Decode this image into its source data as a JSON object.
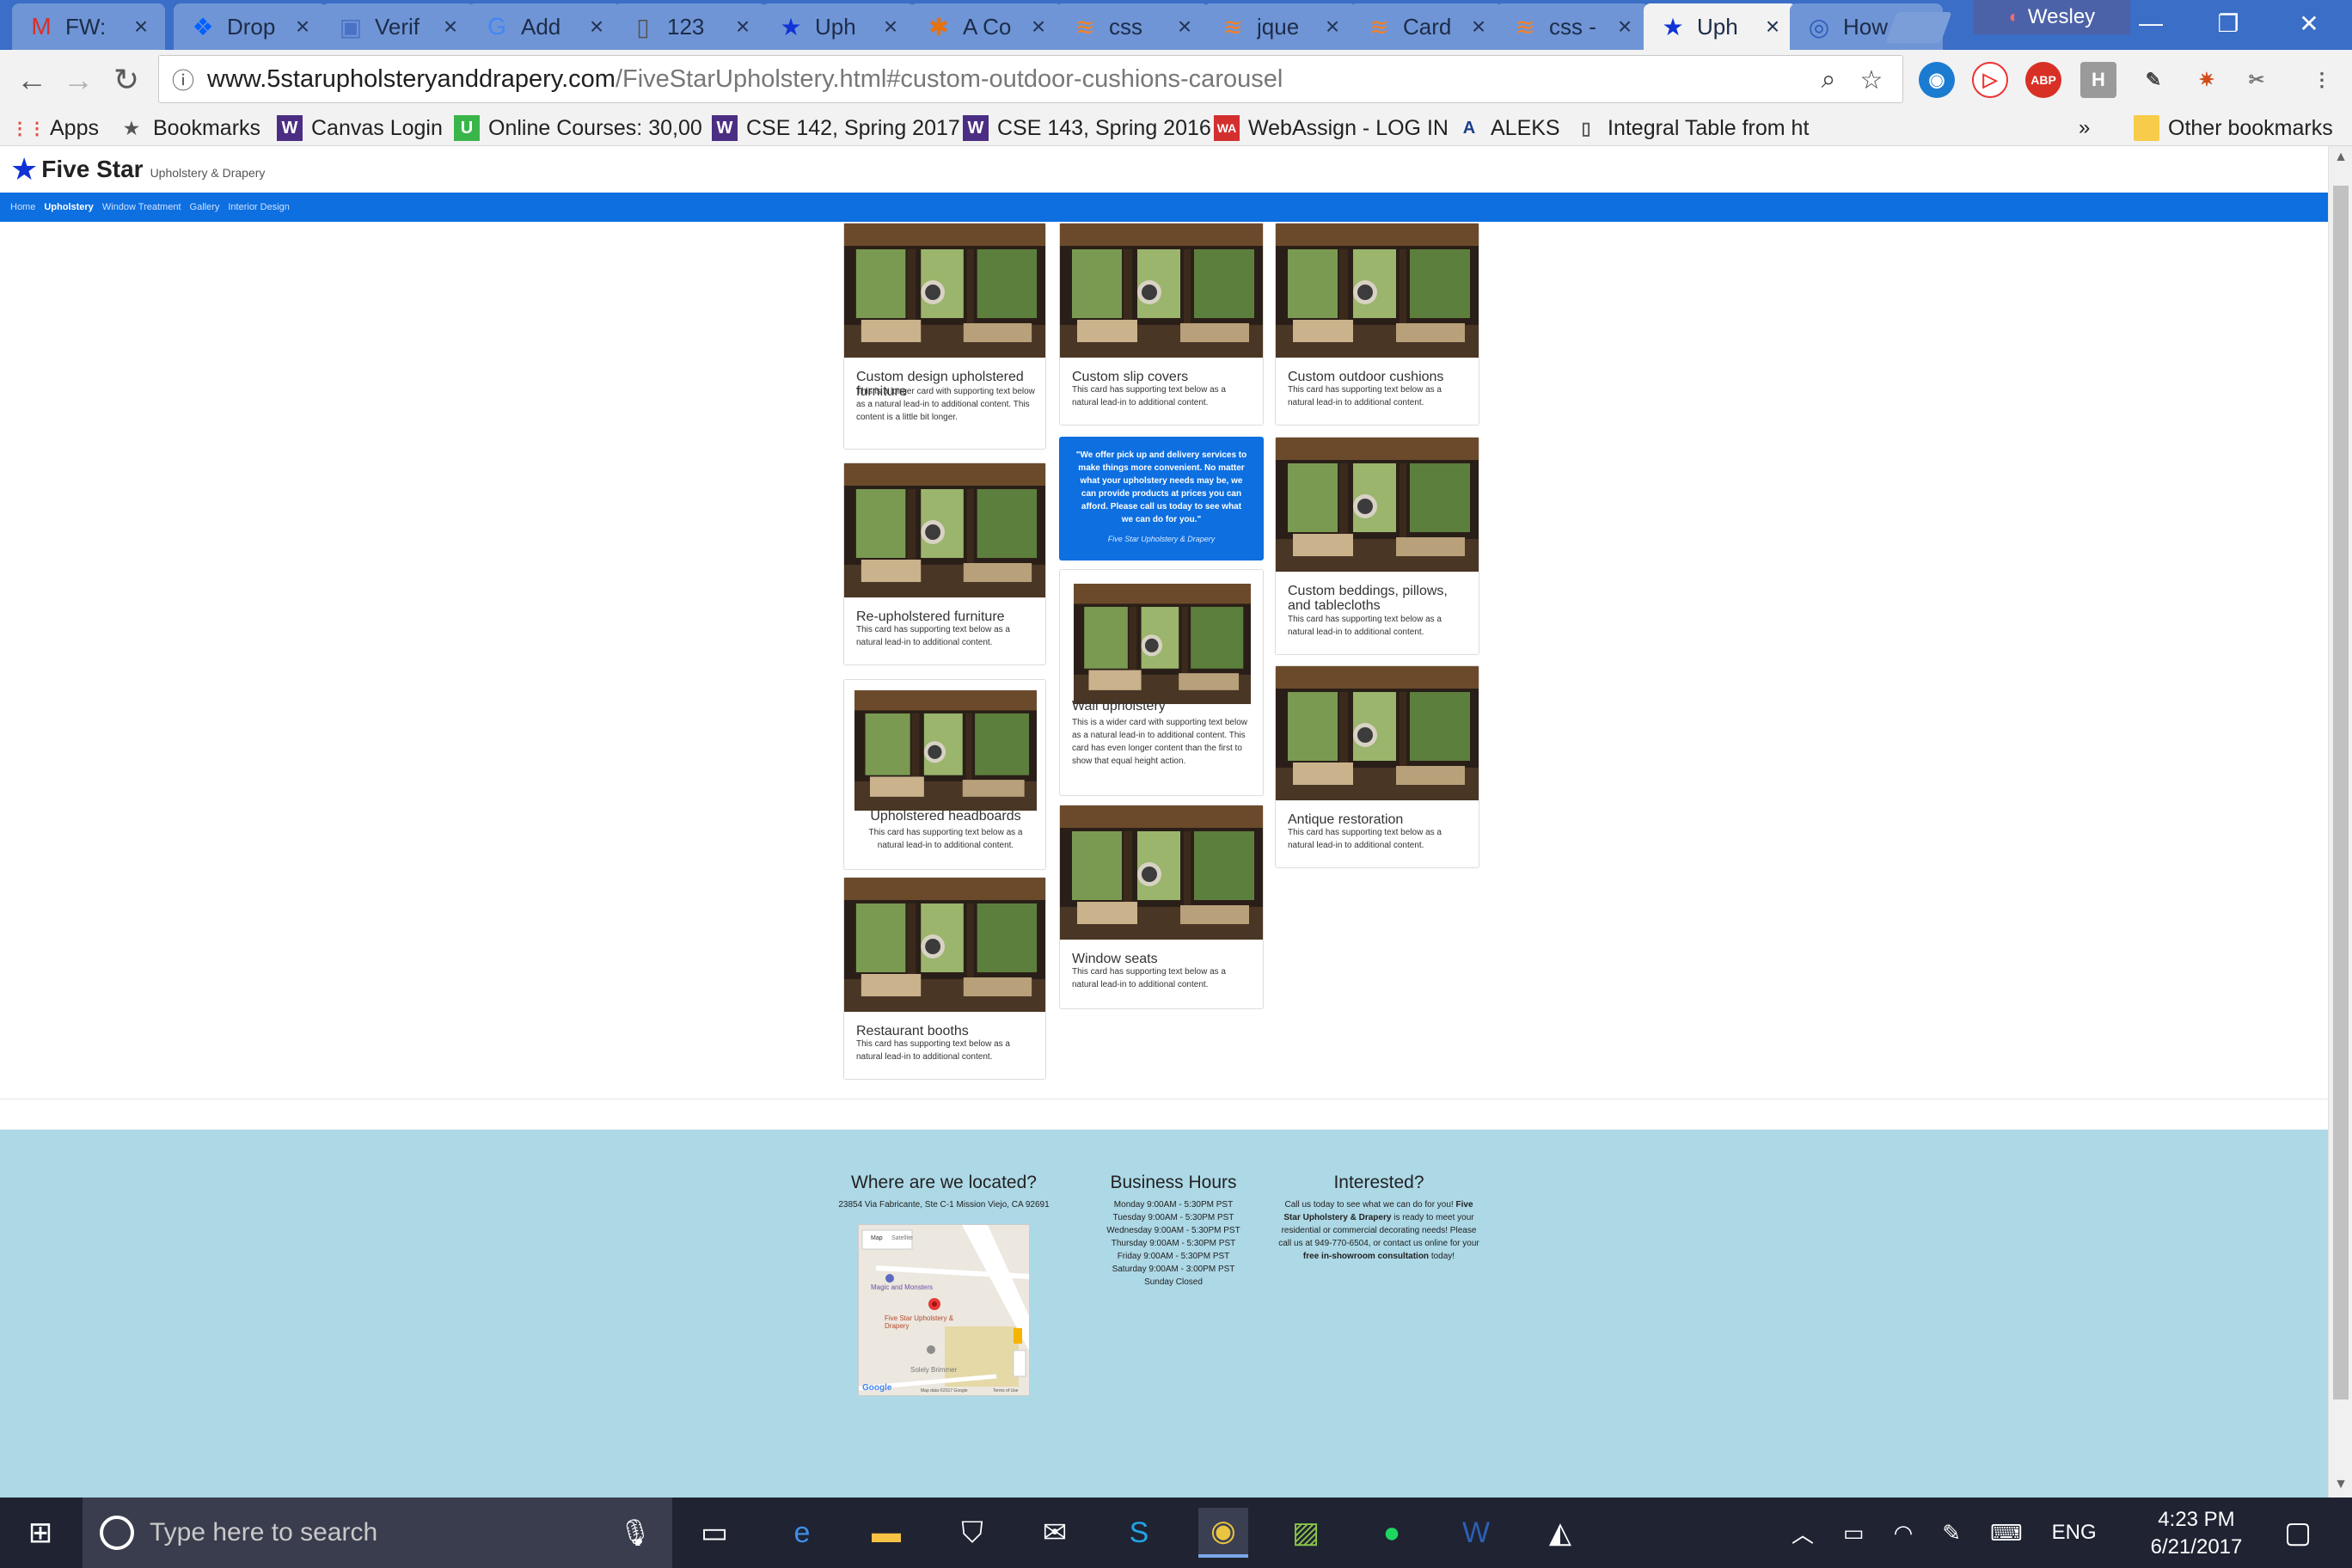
{
  "browser": {
    "tabs": [
      {
        "title": "FW:",
        "icon": "gmail-icon",
        "glyph": "M",
        "color": "#d93025"
      },
      {
        "title": "Drop",
        "icon": "dropbox-icon",
        "glyph": "❖",
        "color": "#0061fe"
      },
      {
        "title": "Verif",
        "icon": "account-icon",
        "glyph": "▣",
        "color": "#4a72c4"
      },
      {
        "title": "Add",
        "icon": "google-icon",
        "glyph": "G",
        "color": "#4285f4"
      },
      {
        "title": "123",
        "icon": "document-icon",
        "glyph": "▯",
        "color": "#555"
      },
      {
        "title": "Uph",
        "icon": "star-favicon-icon",
        "glyph": "★",
        "color": "#1033d6"
      },
      {
        "title": "A Co",
        "icon": "asterisk-icon",
        "glyph": "✱",
        "color": "#e8710a"
      },
      {
        "title": "css",
        "icon": "stackoverflow-icon",
        "glyph": "≋",
        "color": "#f48024"
      },
      {
        "title": "jque",
        "icon": "stackoverflow-icon",
        "glyph": "≋",
        "color": "#f48024"
      },
      {
        "title": "Card",
        "icon": "stackoverflow-icon",
        "glyph": "≋",
        "color": "#f48024"
      },
      {
        "title": "css -",
        "icon": "stackoverflow-icon",
        "glyph": "≋",
        "color": "#f48024"
      },
      {
        "title": "Uph",
        "icon": "star-favicon-icon",
        "glyph": "★",
        "color": "#1033d6",
        "active": true
      },
      {
        "title": "How",
        "icon": "search-favicon-icon",
        "glyph": "◎",
        "color": "#2a5bb8"
      }
    ],
    "profile_name": "Wesley",
    "url_host": "www.5starupholsteryanddrapery.com",
    "url_path": "/FiveStarUpholstery.html#custom-outdoor-cushions-carousel",
    "bookmarks": [
      {
        "label": "Apps",
        "icon": "apps-grid-icon"
      },
      {
        "label": "Bookmarks",
        "icon": "star-icon"
      },
      {
        "label": "Canvas Login",
        "icon": "uw-icon"
      },
      {
        "label": "Online Courses: 30,00",
        "icon": "udemy-icon"
      },
      {
        "label": "CSE 142, Spring 2017",
        "icon": "uw-icon"
      },
      {
        "label": "CSE 143, Spring 2016",
        "icon": "uw-icon"
      },
      {
        "label": "WebAssign - LOG IN",
        "icon": "webassign-icon"
      },
      {
        "label": "ALEKS",
        "icon": "aleks-icon"
      },
      {
        "label": "Integral Table from ht",
        "icon": "page-icon"
      }
    ],
    "bookmarks_overflow": "»",
    "other_bookmarks": "Other bookmarks"
  },
  "site": {
    "logo_text": "Five Star",
    "logo_subtext": "Upholstery & Drapery",
    "nav": [
      "Home",
      "Upholstery",
      "Window Treatment",
      "Gallery",
      "Interior Design"
    ],
    "nav_active": "Upholstery",
    "cards": [
      {
        "title": "Custom design upholstered furniture",
        "text": "This is a longer card with supporting text below as a natural lead-in to additional content. This content is a little bit longer."
      },
      {
        "title": "Custom slip covers",
        "text": "This card has supporting text below as a natural lead-in to additional content."
      },
      {
        "title": "Custom outdoor cushions",
        "text": "This card has supporting text below as a natural lead-in to additional content."
      },
      {
        "title": "Re-upholstered furniture",
        "text": "This card has supporting text below as a natural lead-in to additional content."
      },
      {
        "title": "Custom beddings, pillows, and tablecloths",
        "text": "This card has supporting text below as a natural lead-in to additional content."
      },
      {
        "title": "Wall upholstery",
        "text": "This is a wider card with supporting text below as a natural lead-in to additional content. This card has even longer content than the first to show that equal height action."
      },
      {
        "title": "Upholstered headboards",
        "text": "This card has supporting text below as a natural lead-in to additional content."
      },
      {
        "title": "Antique restoration",
        "text": "This card has supporting text below as a natural lead-in to additional content."
      },
      {
        "title": "Window seats",
        "text": "This card has supporting text below as a natural lead-in to additional content."
      },
      {
        "title": "Restaurant booths",
        "text": "This card has supporting text below as a natural lead-in to additional content."
      }
    ],
    "quote": {
      "text": "\"We offer pick up and delivery services to make things more convenient. No matter what your upholstery needs may be, we can provide products at prices you can afford. Please call us today to see what we can do for you.\"",
      "source": "Five Star Upholstery & Drapery"
    },
    "footer": {
      "location_heading": "Where are we located?",
      "address": "23854 Via Fabricante, Ste C-1 Mission Viejo, CA 92691",
      "map_labels": [
        "Map",
        "Satellite",
        "Magic and Monsters",
        "Five Star Upholstery & Drapery",
        "Solely Brimmer",
        "Google",
        "Map data ©2017 Google",
        "Terms of Use"
      ],
      "hours_heading": "Business Hours",
      "hours": [
        "Monday 9:00AM - 5:30PM PST",
        "Tuesday 9:00AM - 5:30PM PST",
        "Wednesday 9:00AM - 5:30PM PST",
        "Thursday 9:00AM - 5:30PM PST",
        "Friday 9:00AM - 5:30PM PST",
        "Saturday 9:00AM - 3:00PM PST",
        "Sunday Closed"
      ],
      "interest_heading": "Interested?",
      "interest_pre": "Call us today to see what we can do for you!",
      "interest_brand": "Five Star Upholstery & Drapery",
      "interest_mid": "is ready to meet your residential or commercial decorating needs! Please call us at 949-770-6504, or contact us online for your",
      "interest_bold": "free in-showroom consultation",
      "interest_post": "today!"
    }
  },
  "taskbar": {
    "search_placeholder": "Type here to search",
    "language": "ENG",
    "time": "4:23 PM",
    "date": "6/21/2017"
  },
  "colors": {
    "chrome_frame": "#3a6ec7",
    "site_nav": "#0d6fe0",
    "footer_bg": "#add8e6",
    "taskbar": "#1f2332"
  }
}
